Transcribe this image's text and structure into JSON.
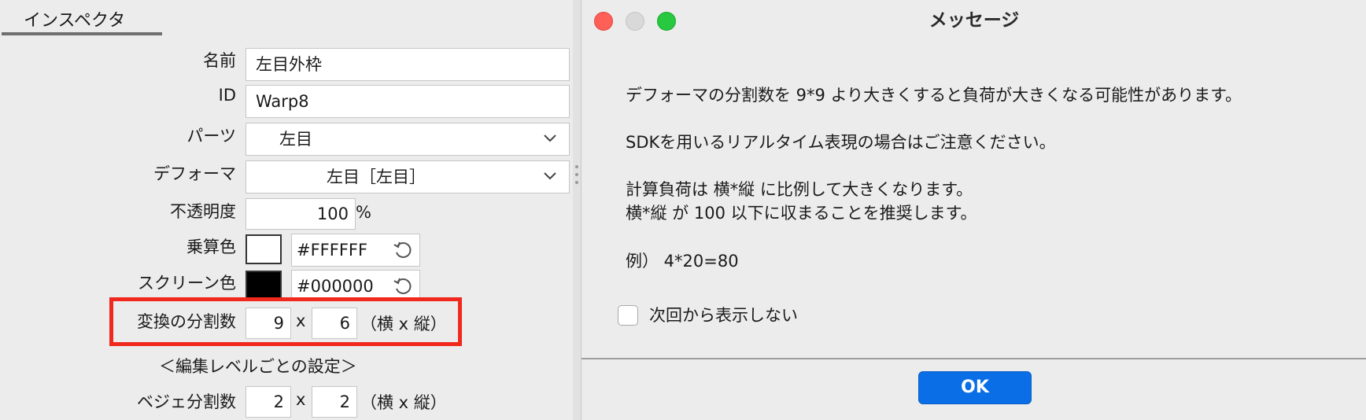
{
  "inspector": {
    "tab_title": "インスペクタ",
    "name": {
      "label": "名前",
      "value": "左目外枠"
    },
    "id": {
      "label": "ID",
      "value": "Warp8"
    },
    "parts": {
      "label": "パーツ",
      "value": "左目"
    },
    "deformer": {
      "label": "デフォーマ",
      "value": "左目［左目］"
    },
    "opacity": {
      "label": "不透明度",
      "value": "100",
      "unit": "%"
    },
    "multiply_color": {
      "label": "乗算色",
      "swatch": "#FFFFFF",
      "value": "#FFFFFF"
    },
    "screen_color": {
      "label": "スクリーン色",
      "swatch": "#000000",
      "value": "#000000"
    },
    "transform_divisions": {
      "label": "変換の分割数",
      "h": "9",
      "x": "x",
      "v": "6",
      "note": "（横 x 縦）"
    },
    "edit_level_header": "＜編集レベルごとの設定＞",
    "bezier_divisions": {
      "label": "ベジェ分割数",
      "h": "2",
      "x": "x",
      "v": "2",
      "note": "（横 x 縦）"
    }
  },
  "dialog": {
    "title": "メッセージ",
    "lines": [
      "デフォーマの分割数を 9*9 より大きくすると負荷が大きくなる可能性があります。",
      "SDKを用いるリアルタイム表現の場合はご注意ください。",
      "計算負荷は 横*縦 に比例して大きくなります。",
      "横*縦 が 100 以下に収まることを推奨します。",
      "例） 4*20=80"
    ],
    "checkbox_label": "次回から表示しない",
    "checkbox_checked": false,
    "ok_label": "OK"
  },
  "colors": {
    "highlight": "#f0281e",
    "ok_button": "#0a6fe6",
    "close": "#fe5f57",
    "minimize_inactive": "#d9d9d9",
    "zoom": "#28c840"
  }
}
